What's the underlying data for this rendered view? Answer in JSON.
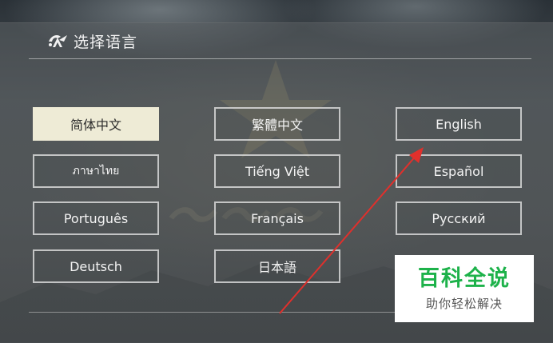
{
  "dialog": {
    "title": "选择语言"
  },
  "languages": [
    {
      "label": "简体中文",
      "selected": true
    },
    {
      "label": "繁體中文",
      "selected": false
    },
    {
      "label": "English",
      "selected": false
    },
    {
      "label": "ภาษาไทย",
      "selected": false
    },
    {
      "label": "Tiếng Việt",
      "selected": false
    },
    {
      "label": "Español",
      "selected": false
    },
    {
      "label": "Português",
      "selected": false
    },
    {
      "label": "Français",
      "selected": false
    },
    {
      "label": "Русский",
      "selected": false
    },
    {
      "label": "Deutsch",
      "selected": false
    },
    {
      "label": "日本語",
      "selected": false
    }
  ],
  "badge": {
    "main": "百科全说",
    "sub": "助你轻松解决"
  },
  "colors": {
    "selected_bg": "#eeebd6",
    "badge_green": "#1db24a",
    "arrow_red": "#e0302c"
  }
}
